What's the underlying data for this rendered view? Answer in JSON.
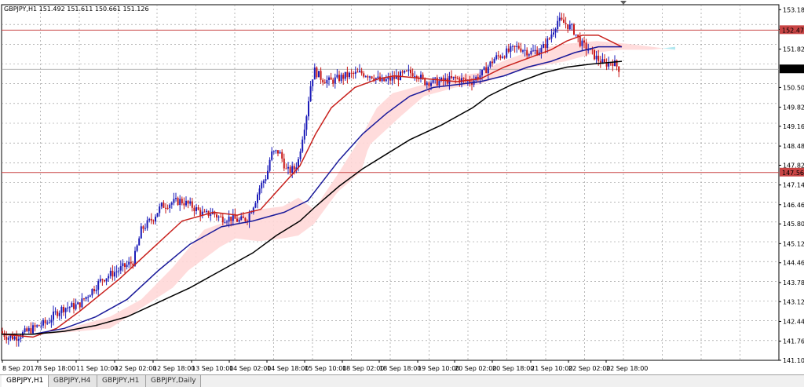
{
  "window": {
    "title": "GBPJPY,H1  151.492 151.611 150.661 151.126"
  },
  "tabs": [
    {
      "label": "GBPJPY,H1",
      "active": true
    },
    {
      "label": "GBPJPY,H4",
      "active": false
    },
    {
      "label": "GBPJPY,H1",
      "active": false
    },
    {
      "label": "GBPJPY,Daily",
      "active": false
    }
  ],
  "colors": {
    "bull": "#1c1cb8",
    "bear": "#c81818",
    "ma_fast": "#c8201c",
    "ma_mid": "#1a1a9a",
    "ma_slow": "#000000",
    "cloud_bear": "#ffd8d8",
    "cloud_bull": "#a8e6ee",
    "hline": "#c84444",
    "price_bg": "#c84444",
    "current_bg": "#000000",
    "grid": "#8c8c8c"
  },
  "chart_data": {
    "type": "candlestick",
    "symbol": "GBPJPY",
    "timeframe": "H1",
    "ohlc_header": {
      "open": 151.492,
      "high": 151.611,
      "low": 150.661,
      "close": 151.126
    },
    "ylim": [
      141.1,
      153.35
    ],
    "grid": true,
    "y_ticks": [
      "153.180",
      "152.500",
      "151.820",
      "151.126",
      "150.500",
      "149.820",
      "149.160",
      "148.480",
      "147.820",
      "147.140",
      "146.460",
      "145.800",
      "145.120",
      "144.460",
      "143.780",
      "143.120",
      "142.440",
      "141.760",
      "141.100"
    ],
    "x_labels": [
      "8 Sep 2017",
      "8 Sep 18:00",
      "11 Sep 10:00",
      "12 Sep 02:00",
      "12 Sep 18:00",
      "13 Sep 10:00",
      "14 Sep 02:00",
      "14 Sep 18:00",
      "15 Sep 10:00",
      "18 Sep 02:00",
      "18 Sep 18:00",
      "19 Sep 10:00",
      "20 Sep 02:00",
      "20 Sep 18:00",
      "21 Sep 10:00",
      "22 Sep 02:00",
      "22 Sep 18:00"
    ],
    "horizontal_lines": [
      {
        "label": "152.476",
        "value": 152.476
      },
      {
        "label": "147.569",
        "value": 147.569
      }
    ],
    "current_price": {
      "label": "151.126",
      "value": 151.126
    },
    "price_path": [
      [
        0,
        142.1
      ],
      [
        10,
        141.9
      ],
      [
        20,
        141.9
      ],
      [
        35,
        142.1
      ],
      [
        50,
        142.3
      ],
      [
        60,
        142.4
      ],
      [
        70,
        142.7
      ],
      [
        80,
        142.9
      ],
      [
        100,
        143.0
      ],
      [
        110,
        143.3
      ],
      [
        130,
        143.9
      ],
      [
        150,
        144.2
      ],
      [
        170,
        144.5
      ],
      [
        180,
        145.6
      ],
      [
        195,
        146.0
      ],
      [
        205,
        146.4
      ],
      [
        215,
        146.5
      ],
      [
        230,
        146.6
      ],
      [
        245,
        146.4
      ],
      [
        260,
        146.1
      ],
      [
        270,
        146.2
      ],
      [
        280,
        146.0
      ],
      [
        295,
        146.0
      ],
      [
        305,
        145.9
      ],
      [
        315,
        146.0
      ],
      [
        325,
        146.6
      ],
      [
        330,
        147.0
      ],
      [
        340,
        147.5
      ],
      [
        345,
        148.2
      ],
      [
        355,
        148.3
      ],
      [
        360,
        148.0
      ],
      [
        365,
        147.6
      ],
      [
        375,
        147.7
      ],
      [
        380,
        148.0
      ],
      [
        385,
        148.8
      ],
      [
        390,
        149.5
      ],
      [
        395,
        150.5
      ],
      [
        400,
        151.1
      ],
      [
        410,
        150.8
      ],
      [
        420,
        150.7
      ],
      [
        440,
        150.9
      ],
      [
        460,
        151.0
      ],
      [
        475,
        150.9
      ],
      [
        485,
        150.7
      ],
      [
        500,
        150.8
      ],
      [
        520,
        151.0
      ],
      [
        530,
        151.0
      ],
      [
        540,
        150.7
      ],
      [
        560,
        150.7
      ],
      [
        580,
        150.8
      ],
      [
        600,
        150.7
      ],
      [
        615,
        151.0
      ],
      [
        630,
        151.5
      ],
      [
        645,
        151.7
      ],
      [
        660,
        151.9
      ],
      [
        675,
        151.7
      ],
      [
        690,
        151.8
      ],
      [
        700,
        152.2
      ],
      [
        710,
        152.8
      ],
      [
        720,
        152.7
      ],
      [
        730,
        152.5
      ],
      [
        740,
        152.0
      ],
      [
        750,
        151.8
      ],
      [
        760,
        151.5
      ],
      [
        770,
        151.3
      ],
      [
        780,
        151.4
      ],
      [
        790,
        151.1
      ]
    ],
    "series": [
      {
        "name": "",
        "kind": "moving-average",
        "values": [
          [
            0,
            142.0
          ],
          [
            40,
            141.9
          ],
          [
            70,
            142.2
          ],
          [
            100,
            142.8
          ],
          [
            150,
            143.9
          ],
          [
            190,
            144.9
          ],
          [
            230,
            145.9
          ],
          [
            270,
            146.2
          ],
          [
            300,
            146.1
          ],
          [
            330,
            146.3
          ],
          [
            360,
            147.2
          ],
          [
            380,
            147.8
          ],
          [
            400,
            148.9
          ],
          [
            420,
            149.8
          ],
          [
            450,
            150.5
          ],
          [
            480,
            150.8
          ],
          [
            500,
            150.9
          ],
          [
            540,
            150.8
          ],
          [
            580,
            150.7
          ],
          [
            610,
            150.8
          ],
          [
            640,
            151.2
          ],
          [
            680,
            151.6
          ],
          [
            700,
            151.8
          ],
          [
            720,
            152.1
          ],
          [
            740,
            152.3
          ],
          [
            760,
            152.3
          ],
          [
            775,
            152.1
          ],
          [
            790,
            151.9
          ]
        ]
      },
      {
        "name": "",
        "kind": "moving-average",
        "values": [
          [
            0,
            142.0
          ],
          [
            40,
            142.0
          ],
          [
            80,
            142.2
          ],
          [
            120,
            142.6
          ],
          [
            160,
            143.2
          ],
          [
            200,
            144.2
          ],
          [
            240,
            145.1
          ],
          [
            280,
            145.7
          ],
          [
            320,
            145.9
          ],
          [
            360,
            146.2
          ],
          [
            390,
            146.6
          ],
          [
            410,
            147.3
          ],
          [
            430,
            148.0
          ],
          [
            460,
            148.9
          ],
          [
            490,
            149.6
          ],
          [
            520,
            150.2
          ],
          [
            550,
            150.5
          ],
          [
            580,
            150.6
          ],
          [
            610,
            150.7
          ],
          [
            640,
            150.9
          ],
          [
            670,
            151.2
          ],
          [
            700,
            151.4
          ],
          [
            730,
            151.7
          ],
          [
            760,
            151.9
          ],
          [
            790,
            151.9
          ]
        ]
      },
      {
        "name": "",
        "kind": "moving-average",
        "values": [
          [
            0,
            142.0
          ],
          [
            40,
            142.0
          ],
          [
            80,
            142.1
          ],
          [
            120,
            142.3
          ],
          [
            160,
            142.6
          ],
          [
            200,
            143.1
          ],
          [
            240,
            143.6
          ],
          [
            280,
            144.2
          ],
          [
            320,
            144.8
          ],
          [
            350,
            145.4
          ],
          [
            380,
            145.9
          ],
          [
            400,
            146.4
          ],
          [
            430,
            147.1
          ],
          [
            460,
            147.7
          ],
          [
            490,
            148.2
          ],
          [
            520,
            148.7
          ],
          [
            560,
            149.2
          ],
          [
            600,
            149.8
          ],
          [
            620,
            150.2
          ],
          [
            650,
            150.6
          ],
          [
            690,
            151.0
          ],
          [
            720,
            151.2
          ],
          [
            750,
            151.3
          ],
          [
            790,
            151.4
          ]
        ]
      }
    ],
    "ichimoku_cloud": {
      "span_a": [
        [
          20,
          142.0
        ],
        [
          60,
          142.0
        ],
        [
          100,
          142.3
        ],
        [
          140,
          142.6
        ],
        [
          180,
          143.2
        ],
        [
          220,
          144.3
        ],
        [
          260,
          145.6
        ],
        [
          300,
          146.0
        ],
        [
          330,
          146.3
        ],
        [
          360,
          146.4
        ],
        [
          380,
          146.7
        ],
        [
          400,
          146.3
        ],
        [
          430,
          147.5
        ],
        [
          460,
          148.8
        ],
        [
          480,
          149.8
        ],
        [
          500,
          150.3
        ],
        [
          540,
          150.6
        ],
        [
          580,
          150.9
        ],
        [
          610,
          151.0
        ],
        [
          640,
          151.4
        ],
        [
          680,
          151.8
        ],
        [
          720,
          152.0
        ],
        [
          760,
          152.1
        ],
        [
          800,
          152.0
        ],
        [
          830,
          151.9
        ],
        [
          860,
          151.8
        ]
      ],
      "span_b": [
        [
          20,
          142.0
        ],
        [
          60,
          142.0
        ],
        [
          100,
          142.1
        ],
        [
          140,
          142.2
        ],
        [
          180,
          142.9
        ],
        [
          220,
          143.6
        ],
        [
          240,
          144.2
        ],
        [
          280,
          145.0
        ],
        [
          300,
          145.3
        ],
        [
          330,
          145.2
        ],
        [
          360,
          145.3
        ],
        [
          380,
          145.4
        ],
        [
          400,
          145.8
        ],
        [
          430,
          146.9
        ],
        [
          460,
          147.6
        ],
        [
          470,
          148.5
        ],
        [
          490,
          149.0
        ],
        [
          510,
          149.5
        ],
        [
          540,
          150.2
        ],
        [
          580,
          150.5
        ],
        [
          610,
          150.6
        ],
        [
          640,
          150.9
        ],
        [
          680,
          151.2
        ],
        [
          720,
          151.4
        ],
        [
          760,
          151.7
        ],
        [
          790,
          151.8
        ],
        [
          830,
          151.8
        ],
        [
          860,
          151.9
        ]
      ]
    }
  }
}
